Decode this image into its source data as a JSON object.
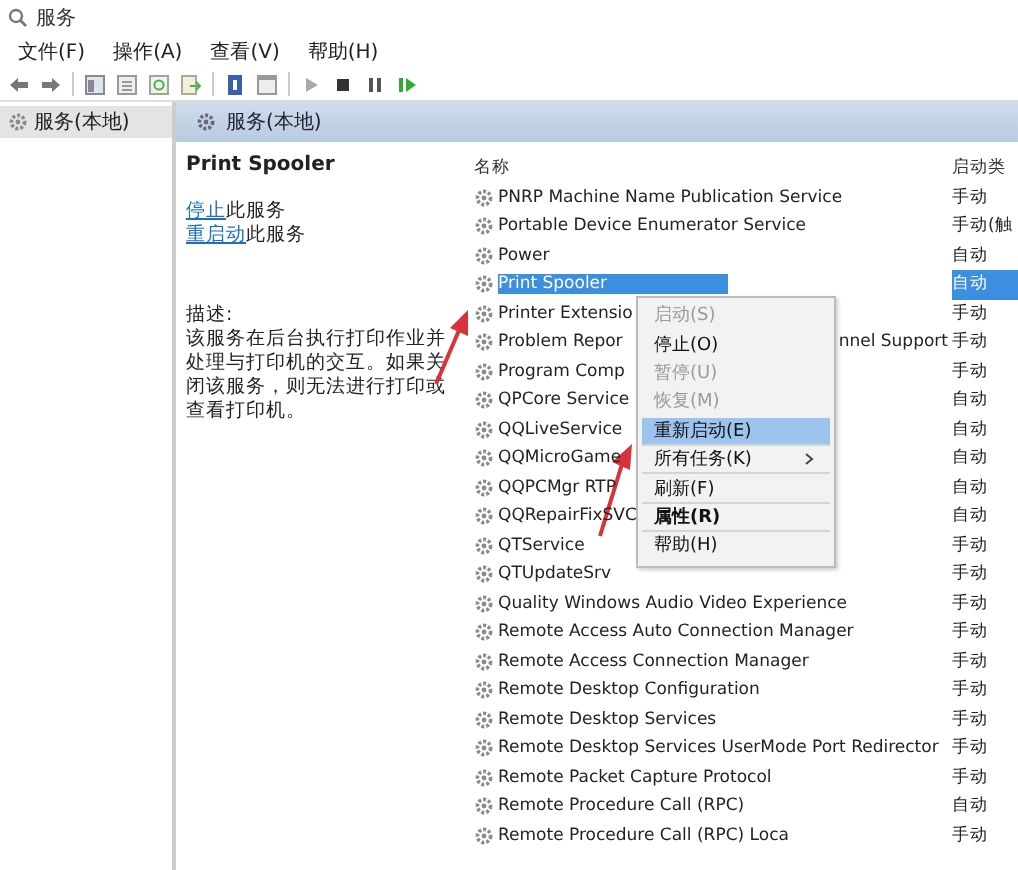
{
  "window": {
    "title": "服务"
  },
  "menubar": [
    "文件(F)",
    "操作(A)",
    "查看(V)",
    "帮助(H)"
  ],
  "tree": [
    {
      "label": "服务(本地)",
      "selected": true
    }
  ],
  "pane_header": "服务(本地)",
  "detail": {
    "title": "Print Spooler",
    "actions": [
      {
        "link": "停止",
        "rest": "此服务"
      },
      {
        "link": "重启动",
        "rest": "此服务"
      }
    ],
    "description_label": "描述:",
    "description": "该服务在后台执行打印作业并处理与打印机的交互。如果关闭该服务，则无法进行打印或查看打印机。"
  },
  "table": {
    "columns": [
      "名称",
      "启动类"
    ],
    "rows": [
      {
        "name": "PNRP Machine Name Publication Service",
        "startup": "手动",
        "selected": false
      },
      {
        "name": "Portable Device Enumerator Service",
        "startup": "手动(触",
        "selected": false
      },
      {
        "name": "Power",
        "startup": "自动",
        "selected": false
      },
      {
        "name": "Print Spooler",
        "startup": "自动",
        "selected": true
      },
      {
        "name": "Printer Extensio",
        "startup": "手动",
        "selected": false
      },
      {
        "name": "Problem Repor",
        "tail": "nnel Support",
        "startup": "手动",
        "selected": false
      },
      {
        "name": "Program Comp",
        "startup": "手动",
        "selected": false
      },
      {
        "name": "QPCore Service",
        "startup": "自动",
        "selected": false
      },
      {
        "name": "QQLiveService",
        "startup": "自动",
        "selected": false
      },
      {
        "name": "QQMicroGame",
        "startup": "自动",
        "selected": false
      },
      {
        "name": "QQPCMgr RTP",
        "startup": "自动",
        "selected": false
      },
      {
        "name": "QQRepairFixSVC",
        "startup": "自动",
        "selected": false
      },
      {
        "name": "QTService",
        "startup": "手动",
        "selected": false
      },
      {
        "name": "QTUpdateSrv",
        "startup": "手动",
        "selected": false
      },
      {
        "name": "Quality Windows Audio Video Experience",
        "startup": "手动",
        "selected": false
      },
      {
        "name": "Remote Access Auto Connection Manager",
        "startup": "手动",
        "selected": false
      },
      {
        "name": "Remote Access Connection Manager",
        "startup": "手动",
        "selected": false
      },
      {
        "name": "Remote Desktop Configuration",
        "startup": "手动",
        "selected": false
      },
      {
        "name": "Remote Desktop Services",
        "startup": "手动",
        "selected": false
      },
      {
        "name": "Remote Desktop Services UserMode Port Redirector",
        "startup": "手动",
        "selected": false
      },
      {
        "name": "Remote Packet Capture Protocol",
        "startup": "手动",
        "selected": false
      },
      {
        "name": "Remote Procedure Call (RPC)",
        "startup": "自动",
        "selected": false
      },
      {
        "name": "Remote Procedure Call (RPC) Loca",
        "startup": "手动",
        "selected": false
      }
    ]
  },
  "context_menu": [
    {
      "label": "启动(S)",
      "disabled": true,
      "highlighted": false,
      "default": false,
      "submenu": false,
      "separator_after": false
    },
    {
      "label": "停止(O)",
      "disabled": false,
      "highlighted": false,
      "default": false,
      "submenu": false,
      "separator_after": false
    },
    {
      "label": "暂停(U)",
      "disabled": true,
      "highlighted": false,
      "default": false,
      "submenu": false,
      "separator_after": false
    },
    {
      "label": "恢复(M)",
      "disabled": true,
      "highlighted": false,
      "default": false,
      "submenu": false,
      "separator_after": false
    },
    {
      "label": "重新启动(E)",
      "disabled": false,
      "highlighted": true,
      "default": false,
      "submenu": false,
      "separator_after": true
    },
    {
      "label": "所有任务(K)",
      "disabled": false,
      "highlighted": false,
      "default": false,
      "submenu": true,
      "separator_after": true
    },
    {
      "label": "刷新(F)",
      "disabled": false,
      "highlighted": false,
      "default": false,
      "submenu": false,
      "separator_after": true
    },
    {
      "label": "属性(R)",
      "disabled": false,
      "highlighted": false,
      "default": true,
      "submenu": false,
      "separator_after": true
    },
    {
      "label": "帮助(H)",
      "disabled": false,
      "highlighted": false,
      "default": false,
      "submenu": false,
      "separator_after": false
    }
  ]
}
